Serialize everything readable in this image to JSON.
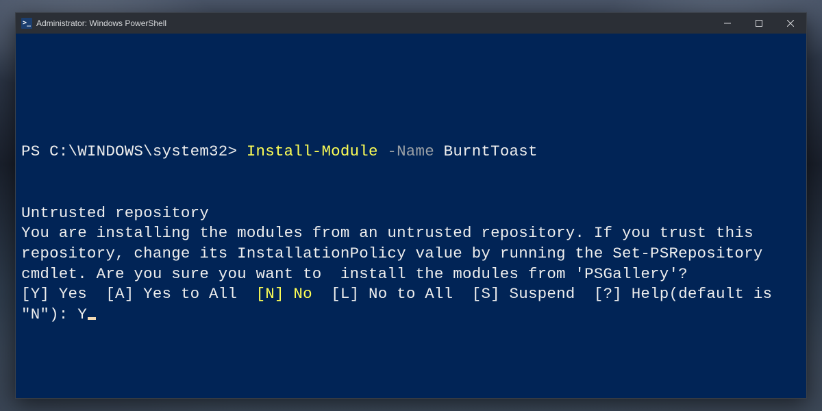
{
  "window": {
    "title": "Administrator: Windows PowerShell",
    "icon_glyph": ">_"
  },
  "colors": {
    "terminal_bg": "#012456",
    "titlebar_bg": "#2b2f36",
    "text": "#e8e8e8",
    "cmd_yellow": "#ffff55",
    "param_gray": "#9aa0a6"
  },
  "terminal": {
    "line1": {
      "prompt": "PS C:\\WINDOWS\\system32> ",
      "command": "Install-Module",
      "space1": " ",
      "param": "-Name",
      "space2": " ",
      "arg": "BurntToast"
    },
    "heading": "Untrusted repository",
    "body": "You are installing the modules from an untrusted repository. If you trust this repository, change its InstallationPolicy value by running the Set-PSRepository cmdlet. Are you sure you want to  install the modules from 'PSGallery'?",
    "options": {
      "yes": "[Y] Yes",
      "sep1": "  ",
      "yes_all": "[A] Yes to All",
      "sep2": "  ",
      "no": "[N] No",
      "sep3": "  ",
      "no_all": "[L] No to All",
      "sep4": "  ",
      "suspend": "[S] Suspend",
      "sep5": "  ",
      "help_prefix": "[?] Help",
      "default_text": "(default is \"N\"): ",
      "input": "Y"
    }
  }
}
